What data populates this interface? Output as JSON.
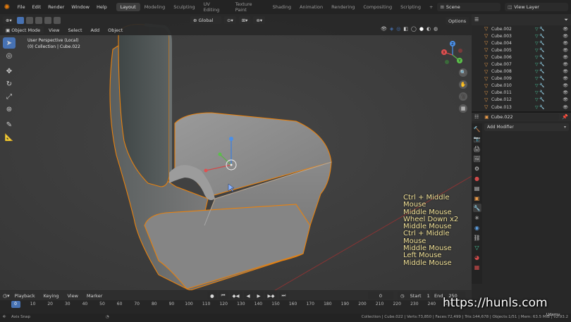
{
  "app": {
    "name": "Blender"
  },
  "topbar": {
    "menus": [
      "File",
      "Edit",
      "Render",
      "Window",
      "Help"
    ],
    "workspaces": [
      "Layout",
      "Modeling",
      "Sculpting",
      "UV Editing",
      "Texture Paint",
      "Shading",
      "Animation",
      "Rendering",
      "Compositing",
      "Scripting"
    ],
    "active_workspace": "Layout",
    "add_workspace": "+",
    "scene": "Scene",
    "view_layer": "View Layer"
  },
  "viewport_header": {
    "mode": "Object Mode",
    "menus": [
      "View",
      "Select",
      "Add",
      "Object"
    ],
    "transform_orientation": "Global",
    "options": "Options"
  },
  "viewport": {
    "perspective_label": "User Perspective (Local)",
    "collection_label": "(0) Collection | Cube.022",
    "gizmo_axes": [
      "X",
      "Y",
      "Z"
    ]
  },
  "key_overlay": [
    "Ctrl + Middle Mouse",
    "Middle Mouse",
    "Wheel Down x2",
    "Middle Mouse",
    "Ctrl + Middle Mouse",
    "Middle Mouse",
    "Left Mouse",
    "Middle Mouse"
  ],
  "outliner": {
    "items": [
      "Cube.002",
      "Cube.003",
      "Cube.004",
      "Cube.005",
      "Cube.006",
      "Cube.007",
      "Cube.008",
      "Cube.009",
      "Cube.010",
      "Cube.011",
      "Cube.012",
      "Cube.013"
    ]
  },
  "properties": {
    "object_name": "Cube.022",
    "add_modifier": "Add Modifier"
  },
  "timeline": {
    "menus": [
      "Playback",
      "Keying",
      "View",
      "Marker"
    ],
    "current_frame": "0",
    "start_label": "Start",
    "start": "1",
    "end_label": "End",
    "end": "250",
    "ticks": [
      "0",
      "10",
      "20",
      "30",
      "40",
      "50",
      "60",
      "70",
      "80",
      "90",
      "100",
      "110",
      "120",
      "130",
      "140",
      "150",
      "160",
      "170",
      "180",
      "190",
      "200",
      "210",
      "220",
      "230",
      "240",
      "250"
    ]
  },
  "status": {
    "left": "Axis Snap",
    "right": "Collection | Cube.022 | Verts:73,850 | Faces:72,499 | Tris:144,678 | Objects:1/51 | Mem: 63.5 MiB | v2.93.2"
  },
  "watermark": {
    "url": "https://hunls.com",
    "brand": "Udemy"
  },
  "colors": {
    "selection_outline": "#e8820f",
    "active_blue": "#4772b3",
    "key_text": "#f4e49a"
  }
}
